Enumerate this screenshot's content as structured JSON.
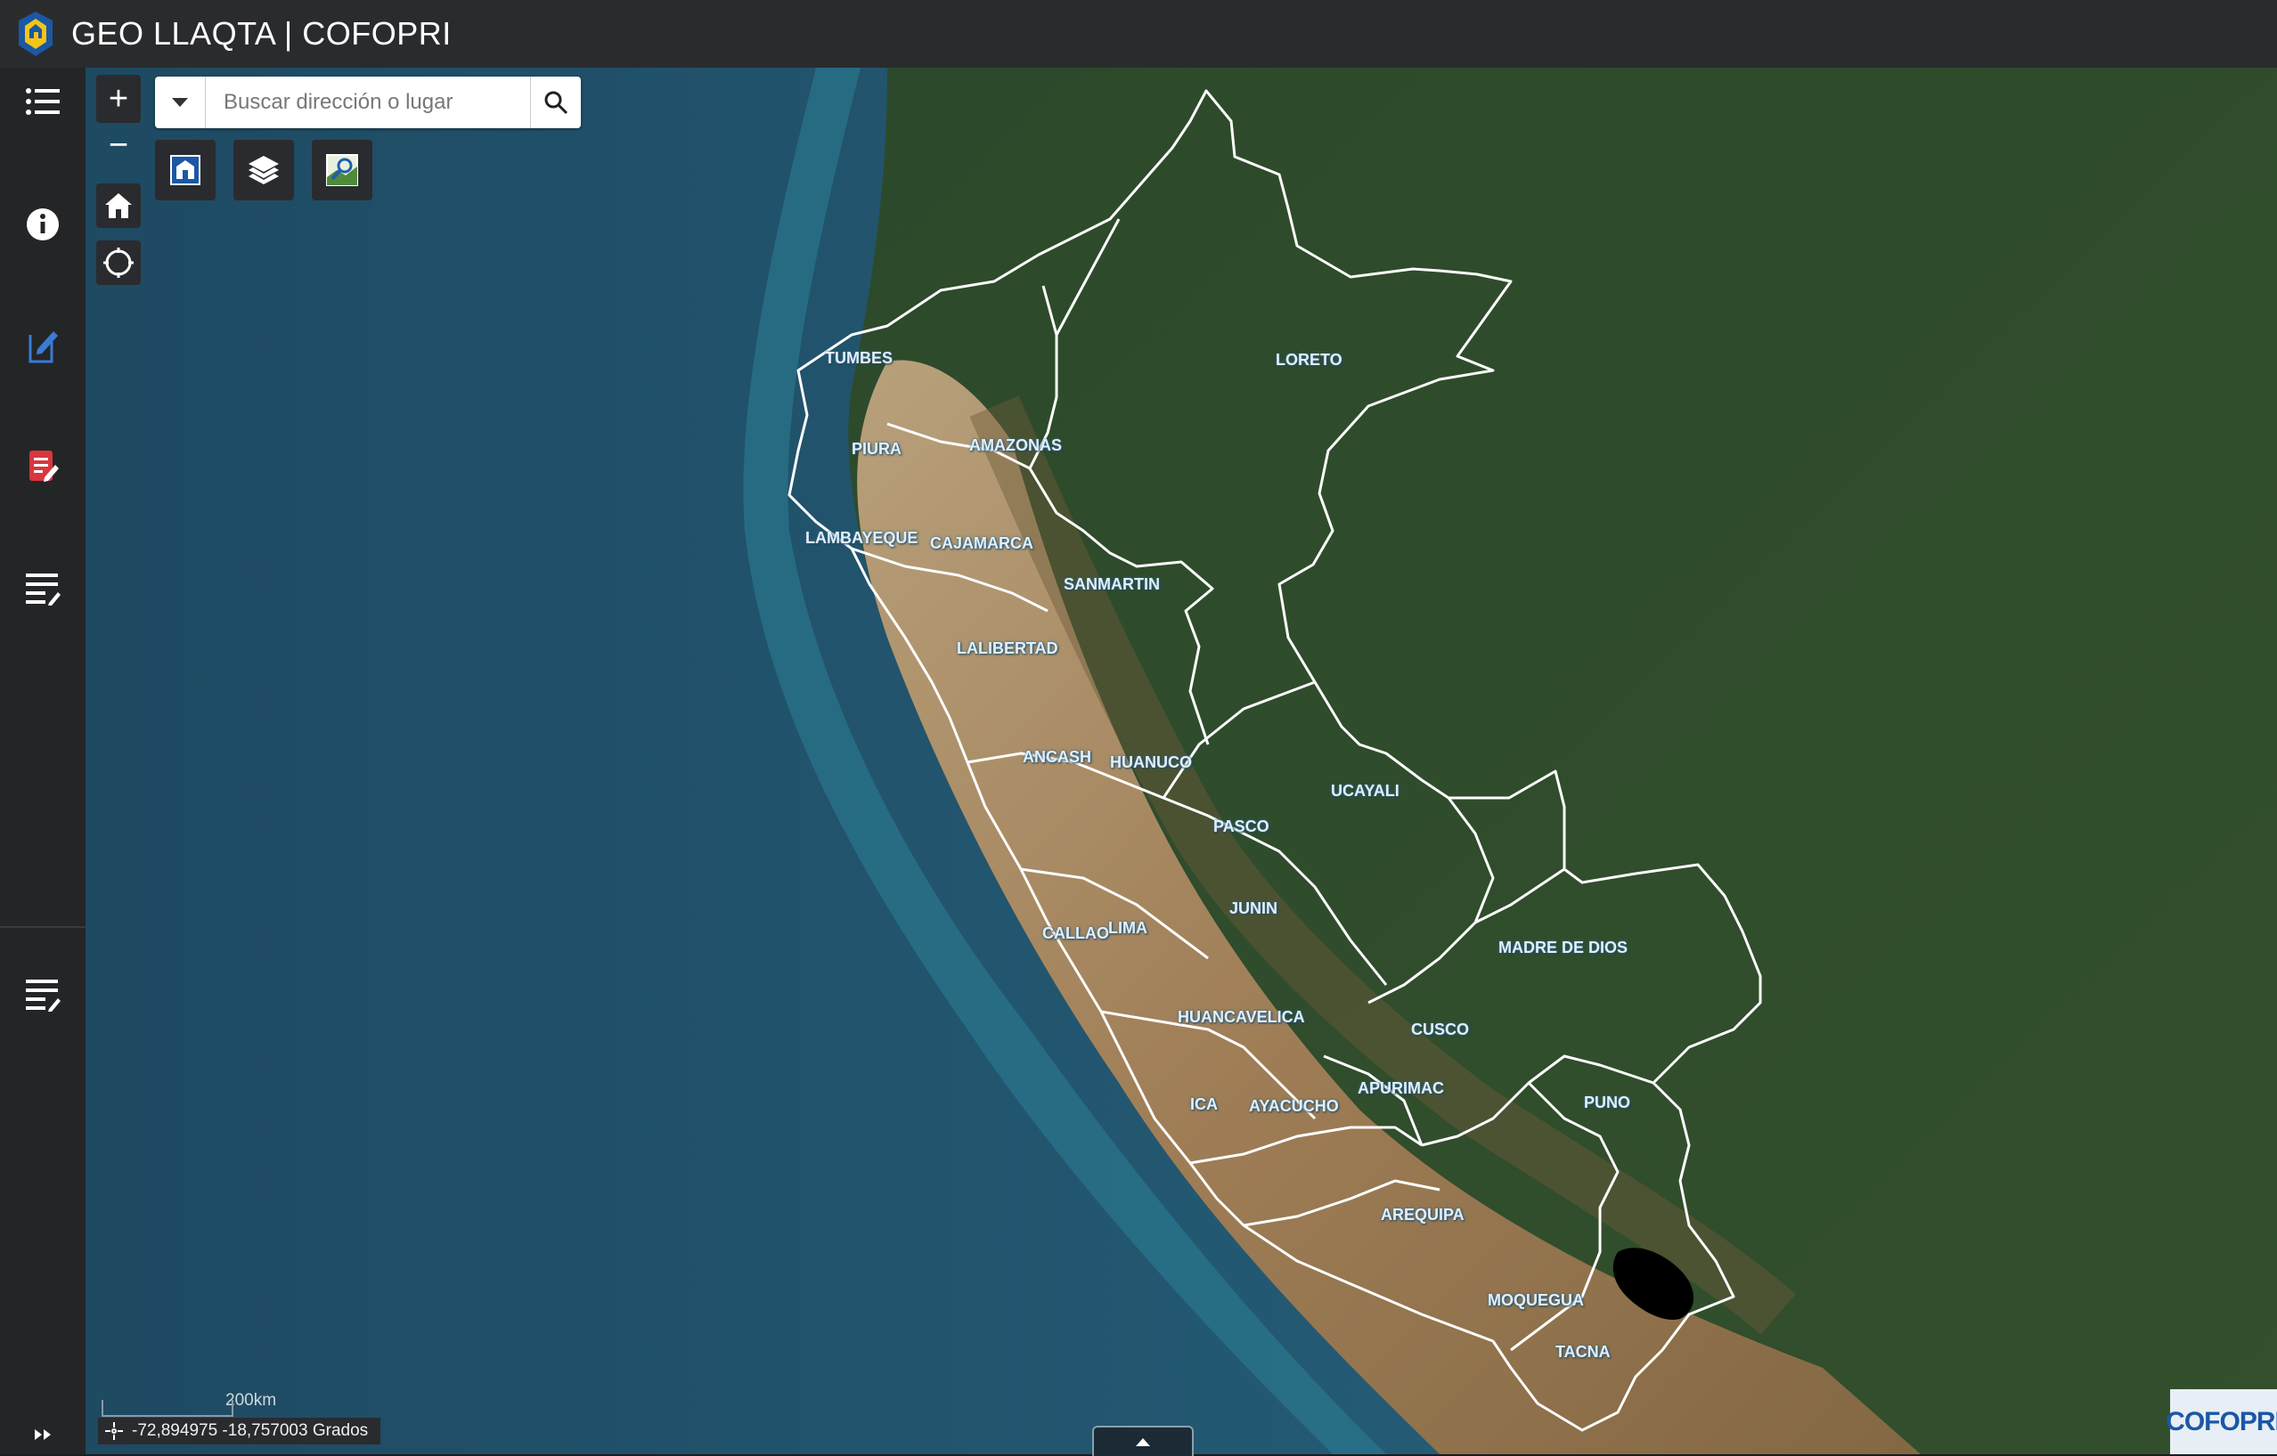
{
  "header": {
    "title": "GEO LLAQTA | COFOPRI",
    "logo_icon": "cofopri-house-icon"
  },
  "sidebar": {
    "items": [
      {
        "name": "layer-list-icon"
      },
      {
        "name": "info-icon"
      },
      {
        "name": "edit-document-icon"
      },
      {
        "name": "report-icon"
      },
      {
        "name": "list-edit-icon"
      },
      {
        "name": "list-edit-icon-2"
      }
    ]
  },
  "map": {
    "zoom_in": "+",
    "zoom_out": "−",
    "search": {
      "placeholder": "Buscar dirección o lugar"
    },
    "regions": [
      "TUMBES",
      "PIURA",
      "LAMBAYEQUE",
      "AMAZONAS",
      "CAJAMARCA",
      "LORETO",
      "SANMARTIN",
      "LALIBERTAD",
      "ANCASH",
      "HUANUCO",
      "UCAYALI",
      "PASCO",
      "JUNIN",
      "CALLAO",
      "LIMA",
      "MADRE DE DIOS",
      "HUANCAVELICA",
      "CUSCO",
      "ICA",
      "AYACUCHO",
      "APURIMAC",
      "PUNO",
      "AREQUIPA",
      "MOQUEGUA",
      "TACNA"
    ],
    "scale_label": "200km",
    "coordinates": "-72,894975 -18,757003 Grados",
    "corner_logo": "COFOPRI"
  },
  "colors": {
    "header_bg": "#2a2b2d",
    "sidebar_bg": "#242527",
    "ocean": "#1f4f66",
    "jungle": "#2e4a2a",
    "desert": "#b89a74"
  }
}
